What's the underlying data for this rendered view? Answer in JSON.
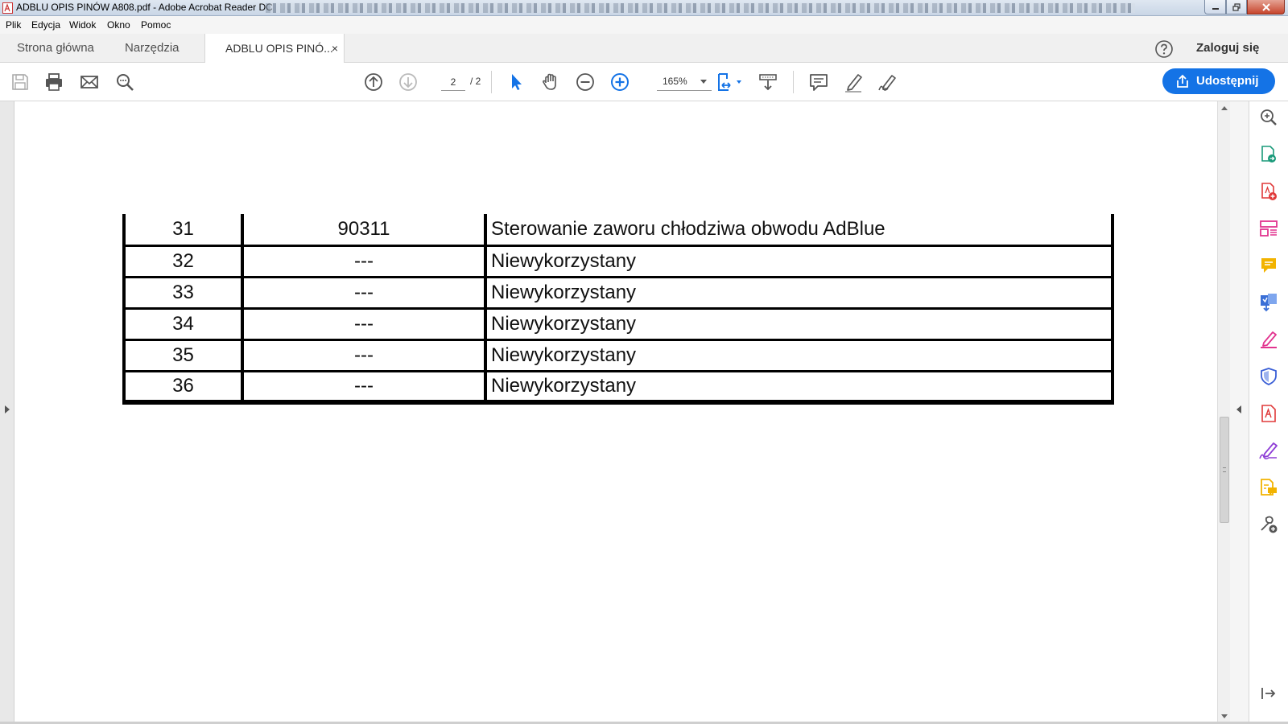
{
  "window": {
    "title": "ADBLU OPIS PINÓW A808.pdf - Adobe Acrobat Reader DC"
  },
  "menu": [
    "Plik",
    "Edycja",
    "Widok",
    "Okno",
    "Pomoc"
  ],
  "tabs": {
    "home": "Strona główna",
    "tools": "Narzędzia",
    "document": "ADBLU OPIS PINÓ...",
    "close_glyph": "×"
  },
  "header": {
    "login": "Zaloguj się"
  },
  "toolbar": {
    "page_current": "2",
    "page_total": "/ 2",
    "zoom": "165%",
    "share_label": "Udostępnij"
  },
  "colors": {
    "accent": "#1473e6",
    "pdf_red": "#e03a3a",
    "comment_yellow": "#f2b300",
    "sign_purple": "#8f3fd6",
    "fill_pink": "#e2348f"
  },
  "document": {
    "rows": [
      {
        "pin": "31",
        "code": "90311",
        "description": "Sterowanie zaworu chłodziwa obwodu AdBlue"
      },
      {
        "pin": "32",
        "code": "---",
        "description": "Niewykorzystany"
      },
      {
        "pin": "33",
        "code": "---",
        "description": "Niewykorzystany"
      },
      {
        "pin": "34",
        "code": "---",
        "description": "Niewykorzystany"
      },
      {
        "pin": "35",
        "code": "---",
        "description": "Niewykorzystany"
      },
      {
        "pin": "36",
        "code": "---",
        "description": "Niewykorzystany"
      }
    ]
  },
  "icons": {
    "toolbar": [
      "save-icon",
      "print-icon",
      "email-icon",
      "search-icon",
      "page-up-icon",
      "page-down-icon",
      "select-cursor-icon",
      "hand-tool-icon",
      "zoom-out-icon",
      "zoom-in-icon",
      "fit-page-icon",
      "scroll-mode-icon",
      "comment-icon",
      "highlight-pen-icon",
      "sign-icon"
    ],
    "right_pane": [
      "enhance-scan-icon",
      "export-pdf-icon",
      "create-pdf-icon",
      "organize-pages-icon",
      "comment-tool-icon",
      "send-for-review-icon",
      "fill-sign-icon",
      "protect-icon",
      "convert-pdf-icon",
      "request-signature-icon",
      "send-comment-icon",
      "more-tools-icon",
      "collapse-pane-icon"
    ]
  }
}
